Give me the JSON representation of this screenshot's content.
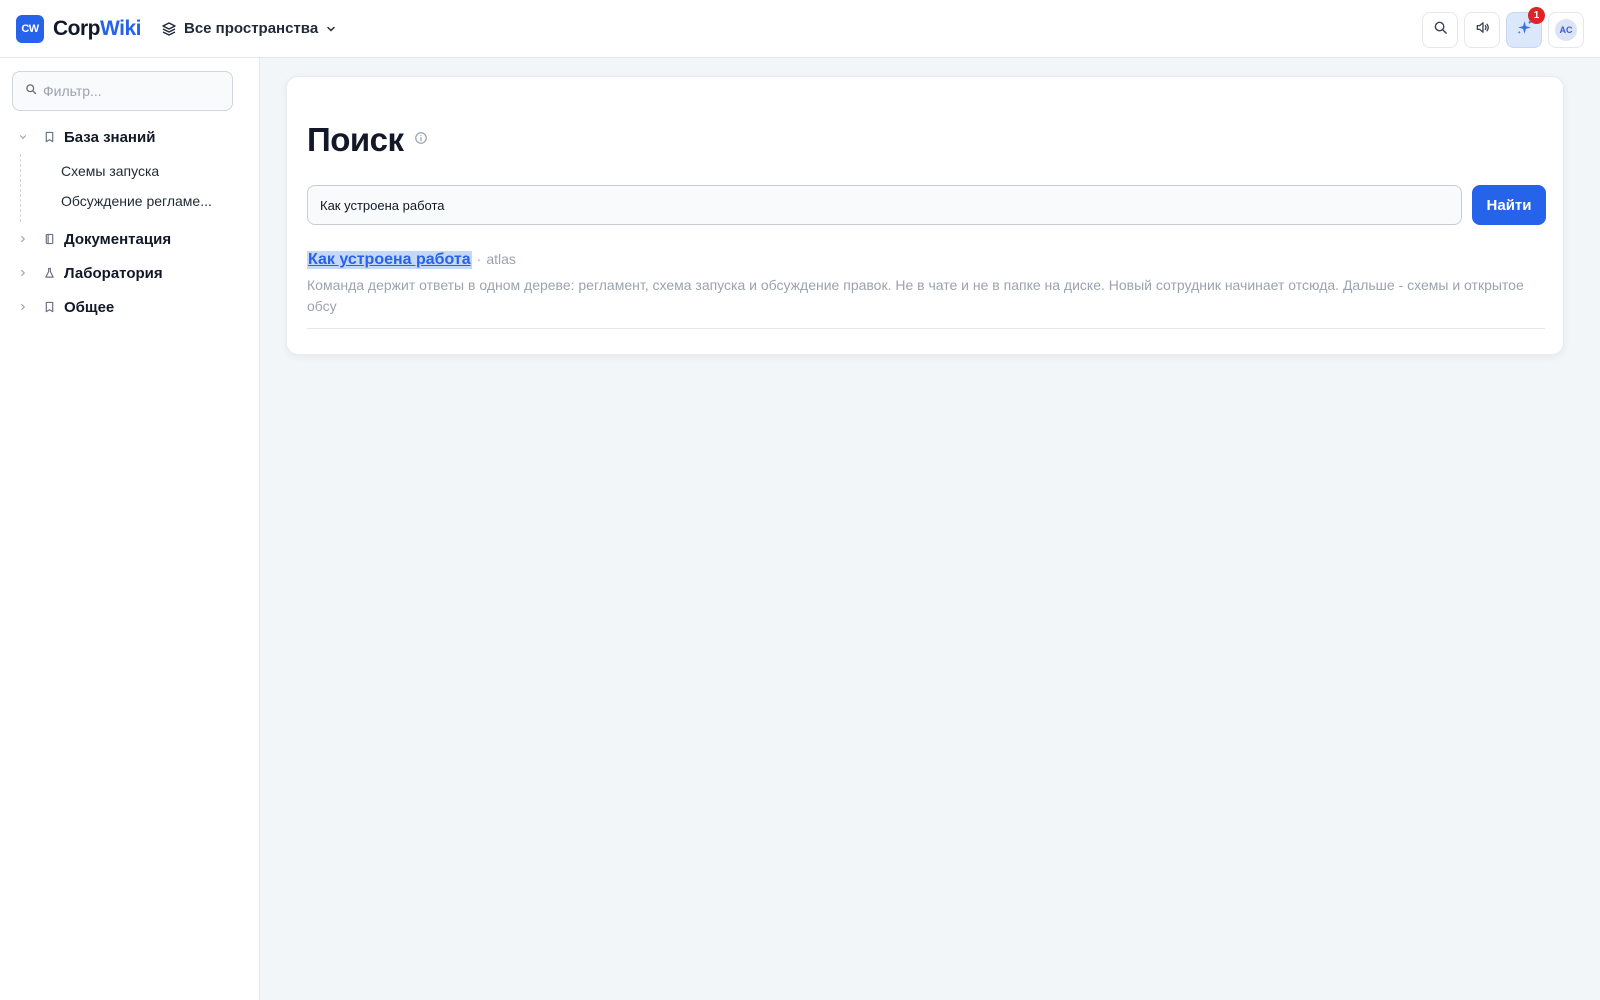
{
  "header": {
    "logo_badge": "CW",
    "logo_part1": "Corp",
    "logo_part2": "Wiki",
    "space_label": "Все пространства",
    "notification_count": "1",
    "avatar_initials": "AC",
    "accent_color": "#2563eb"
  },
  "sidebar": {
    "filter_placeholder": "Фильтр...",
    "tree": [
      {
        "label": "База знаний",
        "icon": "book-icon",
        "expanded": true,
        "children": [
          "Схемы запуска",
          "Обсуждение регламе..."
        ]
      },
      {
        "label": "Документация",
        "icon": "document-icon",
        "expanded": false
      },
      {
        "label": "Лаборатория",
        "icon": "flask-icon",
        "expanded": false
      },
      {
        "label": "Общее",
        "icon": "book-icon",
        "expanded": false
      }
    ]
  },
  "main": {
    "title": "Поиск",
    "search_value": "Как устроена работа",
    "search_button": "Найти",
    "results": [
      {
        "title": "Как устроена работа",
        "separator": "·",
        "space": "atlas",
        "snippet": "Команда держит ответы в одном дереве: регламент, схема запуска и обсуждение правок. Не в чате и не в папке на диске. Новый сотрудник начинает отсюда. Дальше - схемы и открытое обсу"
      }
    ]
  }
}
